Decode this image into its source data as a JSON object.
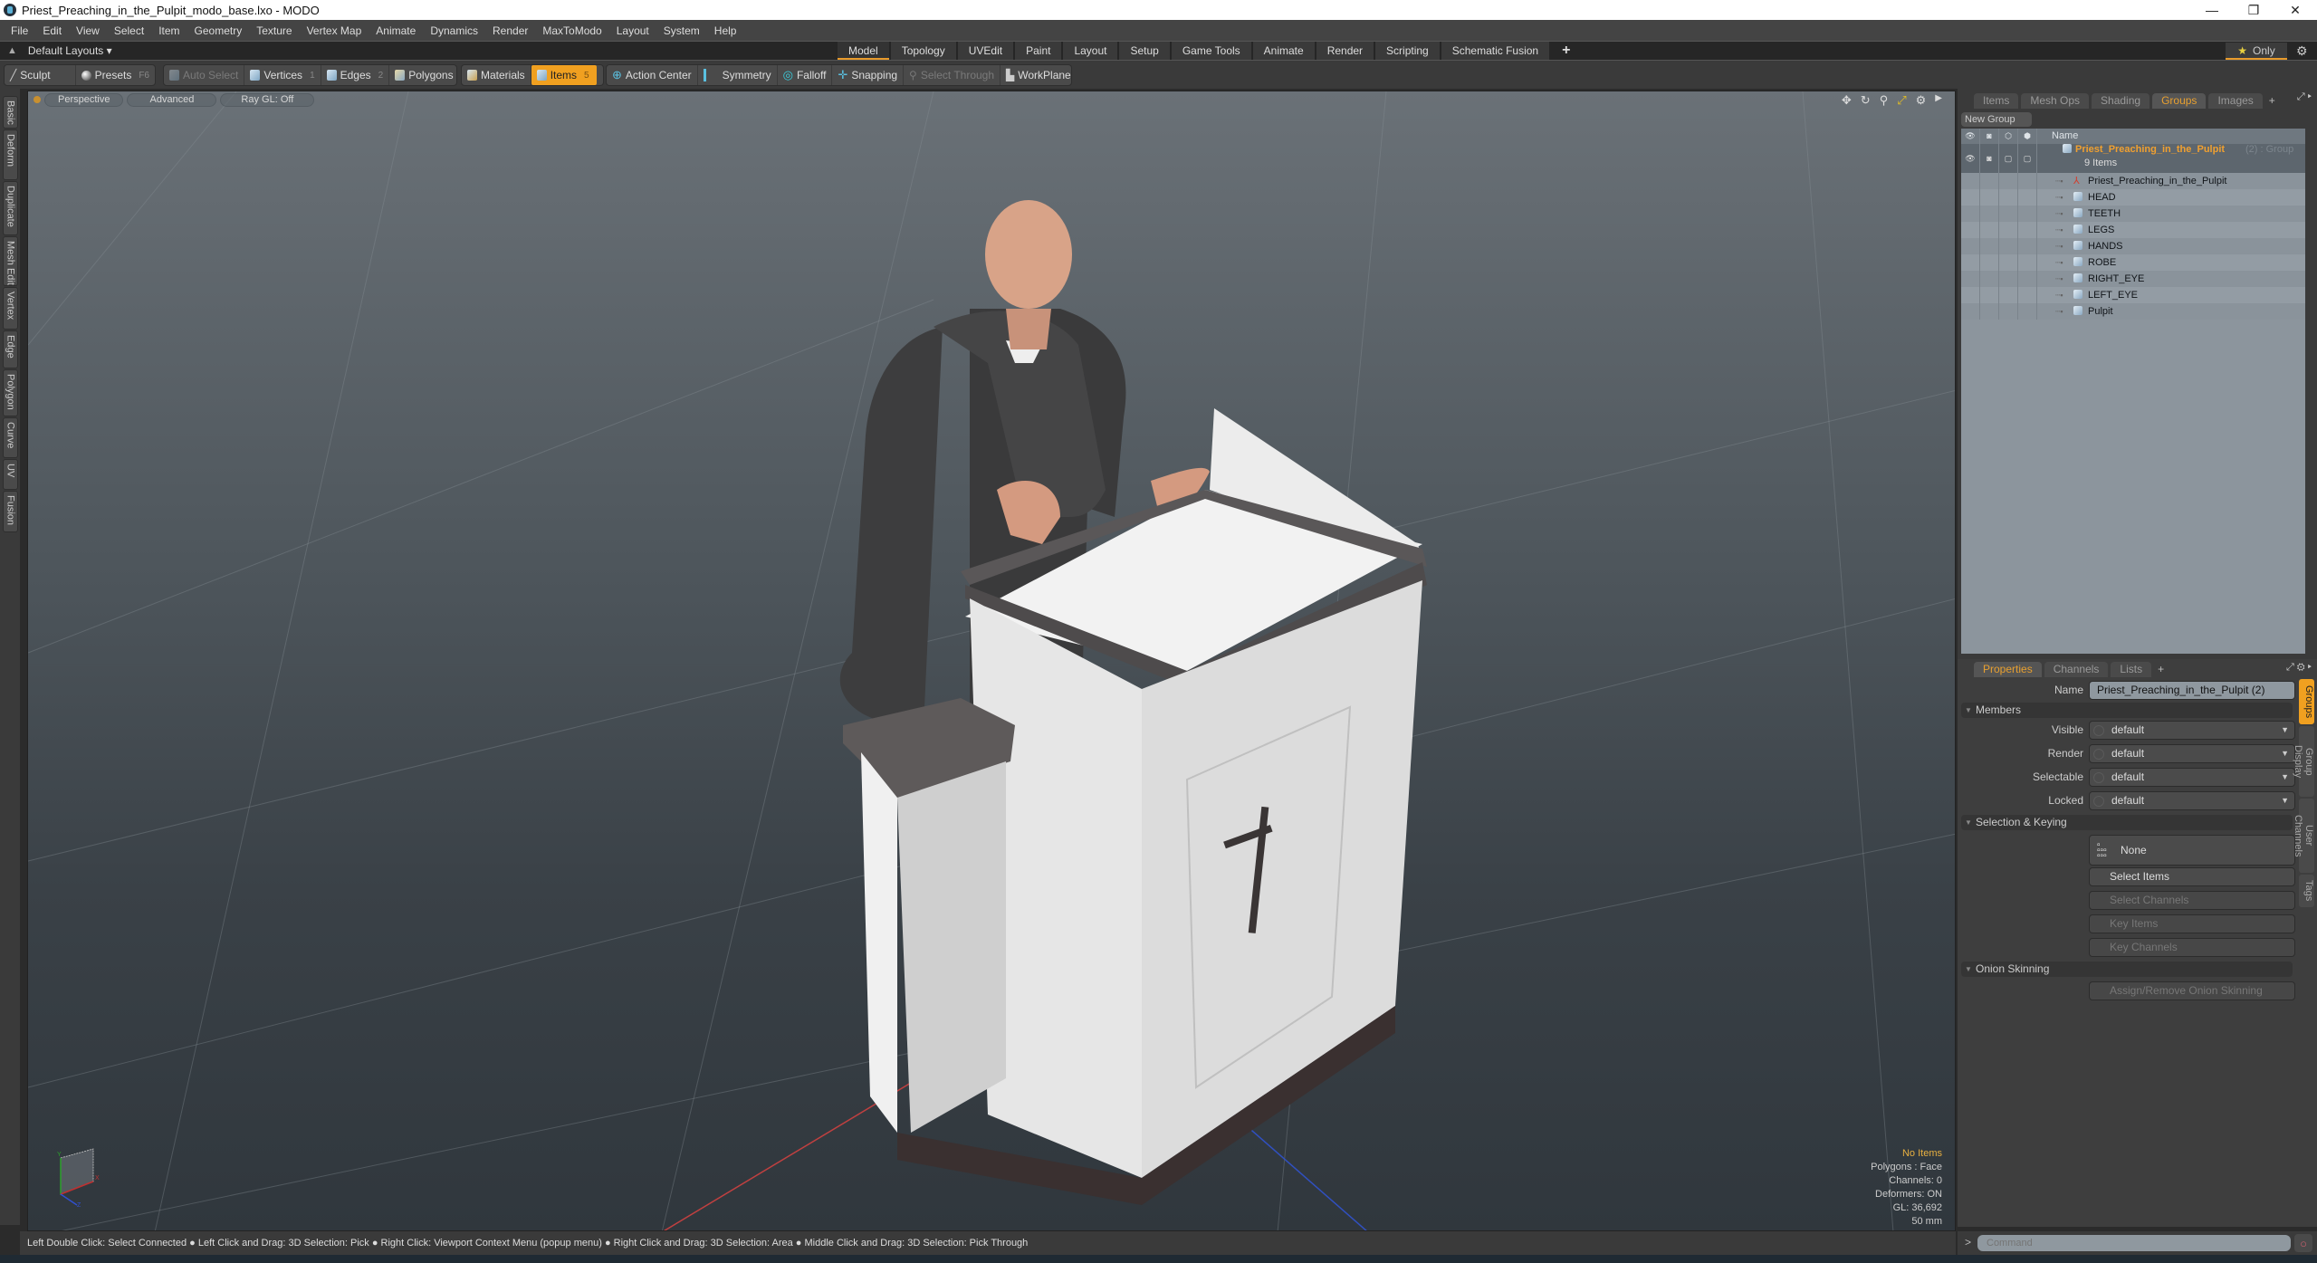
{
  "window": {
    "title": "Priest_Preaching_in_the_Pulpit_modo_base.lxo - MODO",
    "controls": {
      "minimize": "—",
      "maximize": "❐",
      "close": "✕"
    }
  },
  "menu": [
    "File",
    "Edit",
    "View",
    "Select",
    "Item",
    "Geometry",
    "Texture",
    "Vertex Map",
    "Animate",
    "Dynamics",
    "Render",
    "MaxToModo",
    "Layout",
    "System",
    "Help"
  ],
  "layouts": {
    "label": "Default Layouts ▾",
    "tabs": [
      "Model",
      "Topology",
      "UVEdit",
      "Paint",
      "Layout",
      "Setup",
      "Game Tools",
      "Animate",
      "Render",
      "Scripting",
      "Schematic Fusion"
    ],
    "active_tab": "Model",
    "add": "+",
    "only_label": "Only"
  },
  "toolbar": {
    "sculpt": "Sculpt",
    "presets": "Presets",
    "presets_key": "F6",
    "auto_select": "Auto Select",
    "vertices": "Vertices",
    "vertices_key": "1",
    "edges": "Edges",
    "edges_key": "2",
    "polygons": "Polygons",
    "materials": "Materials",
    "items": "Items",
    "items_key": "5",
    "action_center": "Action Center",
    "symmetry": "Symmetry",
    "falloff": "Falloff",
    "snapping": "Snapping",
    "select_through": "Select Through",
    "workplane": "WorkPlane"
  },
  "left_tabs": [
    "Basic",
    "Deform",
    "Duplicate",
    "Mesh Edit",
    "Vertex",
    "Edge",
    "Polygon",
    "Curve",
    "UV",
    "Fusion"
  ],
  "viewport": {
    "view": "Perspective",
    "mode": "Advanced",
    "raygl": "Ray GL: Off",
    "stats": {
      "selection": "No Items",
      "polygons": "Polygons : Face",
      "channels": "Channels: 0",
      "deformers": "Deformers: ON",
      "gl": "GL: 36,692",
      "unit": "50 mm"
    },
    "gizmo": {
      "x": "X",
      "y": "Y",
      "z": "Z"
    }
  },
  "groups_panel": {
    "tabs": [
      "Items",
      "Mesh Ops",
      "Shading",
      "Groups",
      "Images"
    ],
    "active_tab": "Groups",
    "new_group": "New Group",
    "column_name": "Name",
    "group": {
      "name": "Priest_Preaching_in_the_Pulpit",
      "suffix": "(2) : Group",
      "count": "9 Items"
    },
    "items": [
      {
        "name": "Priest_Preaching_in_the_Pulpit",
        "icon": "locator-icon"
      },
      {
        "name": "HEAD",
        "icon": "mesh-icon"
      },
      {
        "name": "TEETH",
        "icon": "mesh-icon"
      },
      {
        "name": "LEGS",
        "icon": "mesh-icon"
      },
      {
        "name": "HANDS",
        "icon": "mesh-icon"
      },
      {
        "name": "ROBE",
        "icon": "mesh-icon"
      },
      {
        "name": "RIGHT_EYE",
        "icon": "mesh-icon"
      },
      {
        "name": "LEFT_EYE",
        "icon": "mesh-icon"
      },
      {
        "name": "Pulpit",
        "icon": "mesh-icon"
      }
    ]
  },
  "properties": {
    "tabs": [
      "Properties",
      "Channels",
      "Lists"
    ],
    "active_tab": "Properties",
    "name_label": "Name",
    "name_value": "Priest_Preaching_in_the_Pulpit (2)",
    "members_section": "Members",
    "members": [
      {
        "label": "Visible",
        "value": "default"
      },
      {
        "label": "Render",
        "value": "default"
      },
      {
        "label": "Selectable",
        "value": "default"
      },
      {
        "label": "Locked",
        "value": "default"
      }
    ],
    "selection_section": "Selection & Keying",
    "selection_value": "None",
    "buttons": [
      {
        "label": "Select Items",
        "enabled": true
      },
      {
        "label": "Select Channels",
        "enabled": false
      },
      {
        "label": "Key Items",
        "enabled": false
      },
      {
        "label": "Key Channels",
        "enabled": false
      }
    ],
    "onion_section": "Onion Skinning",
    "onion_button": "Assign/Remove Onion Skinning",
    "side_tabs": [
      "Groups",
      "Group Display",
      "User Channels",
      "Tags"
    ],
    "active_side_tab": "Groups"
  },
  "status_bar": "Left Double Click: Select Connected ● Left Click and Drag: 3D Selection: Pick ● Right Click: Viewport Context Menu (popup menu) ● Right Click and Drag: 3D Selection: Area ● Middle Click and Drag: 3D Selection: Pick Through",
  "command": {
    "prompt": ">",
    "placeholder": "Command"
  },
  "colors": {
    "accent": "#f0a020",
    "group_name": "#f0a030"
  }
}
